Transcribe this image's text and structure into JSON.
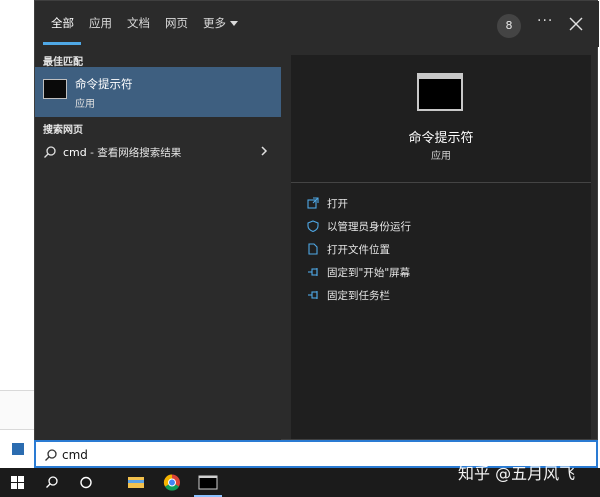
{
  "tabs": [
    {
      "label": "全部",
      "active": true
    },
    {
      "label": "应用"
    },
    {
      "label": "文档"
    },
    {
      "label": "网页"
    },
    {
      "label": "更多"
    }
  ],
  "header": {
    "badge": "8",
    "more_options": "···"
  },
  "left": {
    "best_match_heading": "最佳匹配",
    "best_match": {
      "title": "命令提示符",
      "subtitle": "应用",
      "icon": "cmd-icon"
    },
    "web_heading": "搜索网页",
    "web_result": {
      "query": "cmd",
      "suffix": " - 查看网络搜索结果"
    }
  },
  "right": {
    "app_title": "命令提示符",
    "app_sub": "应用",
    "actions": [
      {
        "label": "打开",
        "icon": "open-icon"
      },
      {
        "label": "以管理员身份运行",
        "icon": "admin-shield-icon"
      },
      {
        "label": "打开文件位置",
        "icon": "file-location-icon"
      },
      {
        "label": "固定到\"开始\"屏幕",
        "icon": "pin-icon"
      },
      {
        "label": "固定到任务栏",
        "icon": "pin-icon"
      }
    ]
  },
  "search": {
    "value": "cmd"
  },
  "watermark": "知乎 @五月风飞",
  "colors": {
    "accent": "#4fa8e6",
    "selected": "#3e5f80",
    "panel": "#2b2b2b",
    "preview": "#1f1f1f"
  }
}
